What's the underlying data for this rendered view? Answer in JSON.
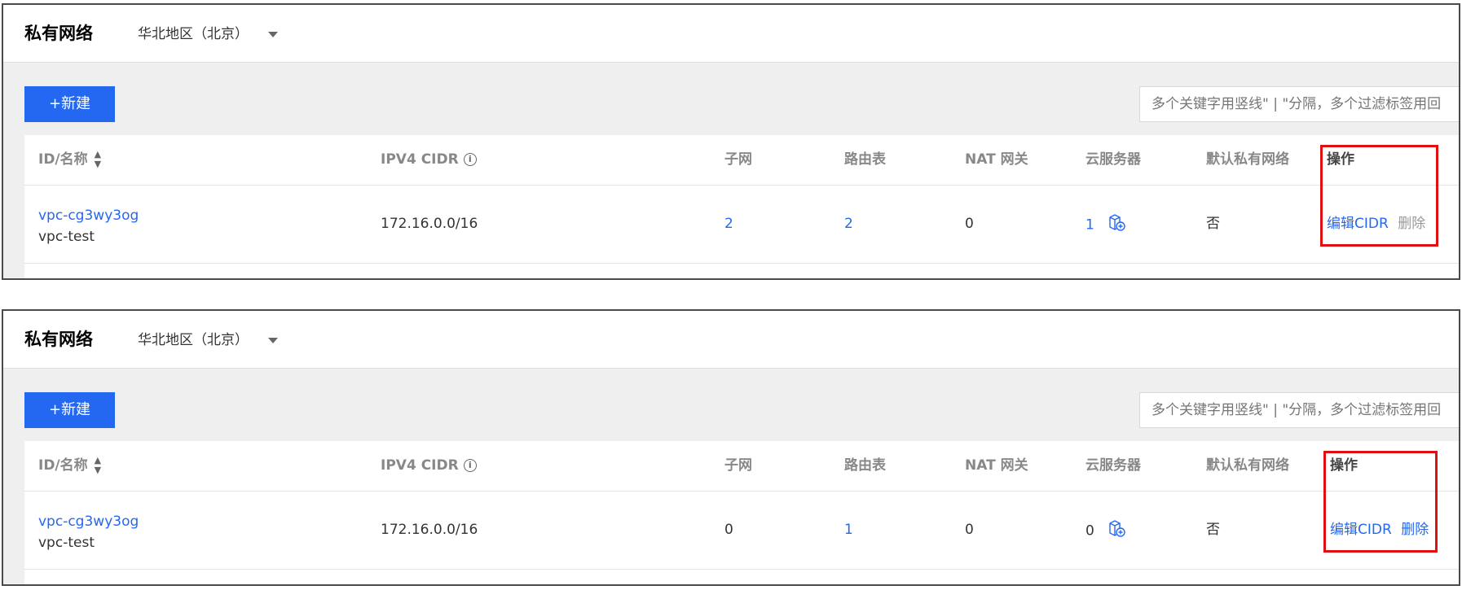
{
  "panels": [
    {
      "title": "私有网络",
      "region": "华北地区（北京）",
      "new_button": "+新建",
      "search_placeholder": "多个关键字用竖线\" | \"分隔，多个过滤标签用回",
      "columns": {
        "id_name": "ID/名称",
        "ipv4_cidr": "IPV4 CIDR",
        "subnet": "子网",
        "route_table": "路由表",
        "nat_gateway": "NAT 网关",
        "cloud_server": "云服务器",
        "default_vpc": "默认私有网络",
        "actions": "操作"
      },
      "row": {
        "id": "vpc-cg3wy3og",
        "name": "vpc-test",
        "cidr": "172.16.0.0/16",
        "subnet": "2",
        "route_table": "2",
        "nat_gateway": "0",
        "cloud_server": "1",
        "default_vpc": "否",
        "edit_cidr": "编辑CIDR",
        "delete": "删除",
        "delete_enabled": false
      }
    },
    {
      "title": "私有网络",
      "region": "华北地区（北京）",
      "new_button": "+新建",
      "search_placeholder": "多个关键字用竖线\" | \"分隔，多个过滤标签用回",
      "columns": {
        "id_name": "ID/名称",
        "ipv4_cidr": "IPV4 CIDR",
        "subnet": "子网",
        "route_table": "路由表",
        "nat_gateway": "NAT 网关",
        "cloud_server": "云服务器",
        "default_vpc": "默认私有网络",
        "actions": "操作"
      },
      "row": {
        "id": "vpc-cg3wy3og",
        "name": "vpc-test",
        "cidr": "172.16.0.0/16",
        "subnet": "0",
        "route_table": "1",
        "nat_gateway": "0",
        "cloud_server": "0",
        "default_vpc": "否",
        "edit_cidr": "编辑CIDR",
        "delete": "删除",
        "delete_enabled": true
      }
    }
  ],
  "colors": {
    "primary": "#2468f2",
    "highlight": "#e01010",
    "disabled_text": "#999999"
  }
}
